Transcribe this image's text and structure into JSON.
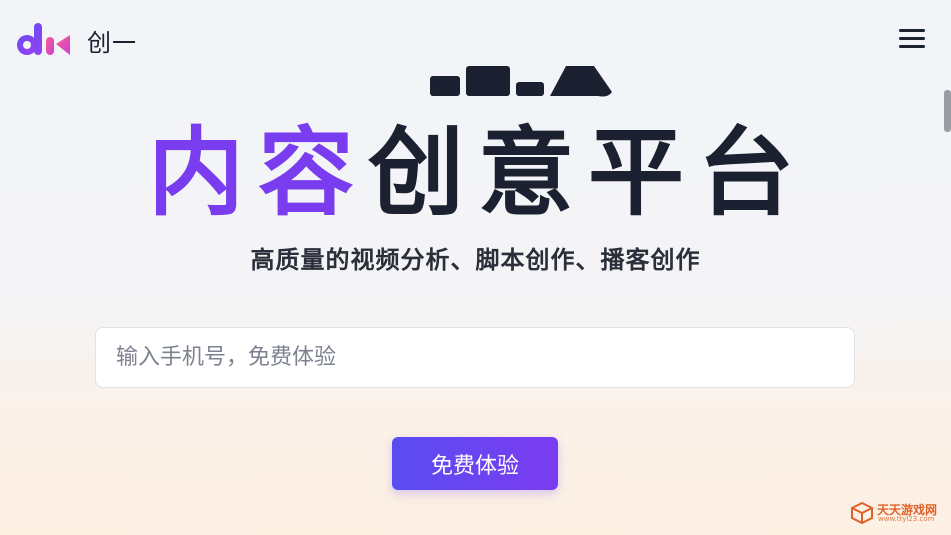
{
  "header": {
    "brand_name": "创一",
    "menu_icon": "hamburger-menu-icon"
  },
  "hero": {
    "title_accent": "内容",
    "title_main": "创意平台",
    "subtitle": "高质量的视频分析、脚本创作、播客创作"
  },
  "form": {
    "phone_placeholder": "输入手机号，免费体验",
    "phone_value": "",
    "submit_label": "免费体验"
  },
  "watermark": {
    "text": "天天游戏网",
    "url": "www.ttyl23.com"
  },
  "colors": {
    "accent_purple": "#7a3cef",
    "button_gradient_start": "#5a4cf0",
    "button_gradient_end": "#7b3cf0",
    "dark_text": "#1b2130",
    "watermark_orange": "#e0622a"
  }
}
